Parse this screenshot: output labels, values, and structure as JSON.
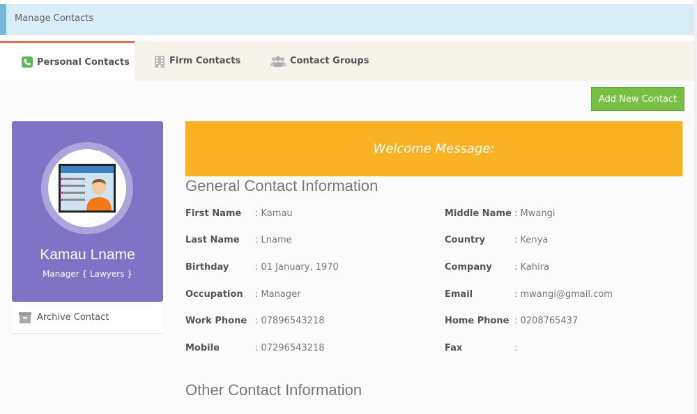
{
  "breadcrumb": {
    "title": "Manage Contacts"
  },
  "tabs": [
    {
      "label": "Personal Contacts",
      "icon": "phone-icon",
      "active": true,
      "color": "#5cb85c"
    },
    {
      "label": "Firm Contacts",
      "icon": "building-icon",
      "active": false
    },
    {
      "label": "Contact Groups",
      "icon": "users-icon",
      "active": false
    }
  ],
  "toolbar": {
    "add_label": "Add New Contact"
  },
  "profile": {
    "name": "Kamau Lname",
    "role": "Manager { Lawyers }",
    "archive_label": "Archive Contact"
  },
  "welcome": {
    "text": "Welcome Message:"
  },
  "general": {
    "title": "General Contact Information",
    "left": [
      {
        "label": "First Name",
        "value": ": Kamau"
      },
      {
        "label": "Last Name",
        "value": ": Lname"
      },
      {
        "label": "Birthday",
        "value": ": 01 January, 1970"
      },
      {
        "label": "Occupation",
        "value": ": Manager"
      },
      {
        "label": "Work Phone",
        "value": ": 07896543218"
      },
      {
        "label": "Mobile",
        "value": ": 07296543218"
      }
    ],
    "right": [
      {
        "label": "Middle Name",
        "value": ": Mwangi"
      },
      {
        "label": "Country",
        "value": ": Kenya"
      },
      {
        "label": "Company",
        "value": ": Kahira"
      },
      {
        "label": "Email",
        "value": ": mwangi@gmail.com"
      },
      {
        "label": "Home Phone",
        "value": ": 0208765437"
      },
      {
        "label": "Fax",
        "value": ":"
      }
    ]
  },
  "other": {
    "title": "Other Contact Information"
  },
  "colors": {
    "accent_green": "#77c043",
    "profile_purple": "#7f73c6",
    "banner_orange": "#f9b224",
    "tab_active_border": "#e8705a"
  }
}
